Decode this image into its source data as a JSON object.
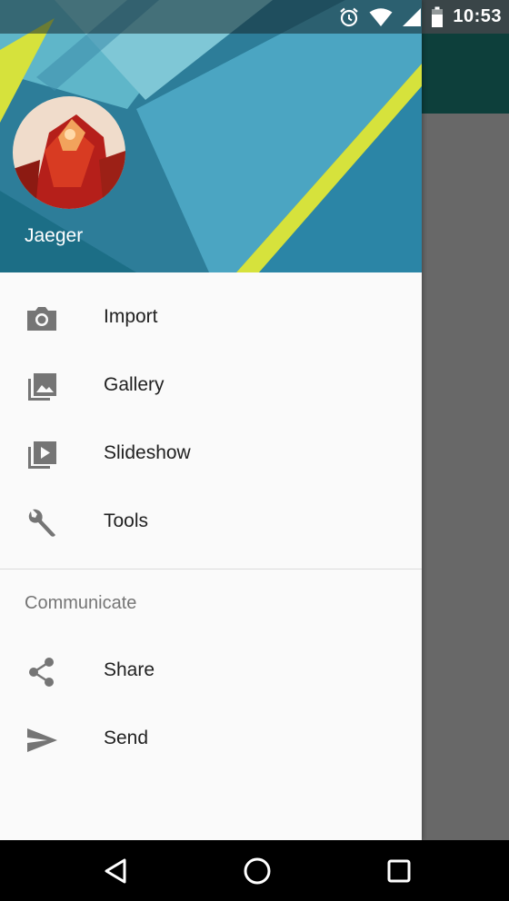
{
  "status_bar": {
    "time": "10:53",
    "icons": [
      "alarm-icon",
      "wifi-icon",
      "signal-icon",
      "battery-icon"
    ]
  },
  "drawer": {
    "header": {
      "user_name": "Jaeger",
      "colors": {
        "primary": "#2a7f9e",
        "accent": "#d6e23c"
      }
    },
    "items": [
      {
        "label": "Import",
        "icon": "camera-icon"
      },
      {
        "label": "Gallery",
        "icon": "photo-library-icon"
      },
      {
        "label": "Slideshow",
        "icon": "slideshow-icon"
      },
      {
        "label": "Tools",
        "icon": "wrench-icon"
      }
    ],
    "section": {
      "title": "Communicate",
      "items": [
        {
          "label": "Share",
          "icon": "share-icon"
        },
        {
          "label": "Send",
          "icon": "send-icon"
        }
      ]
    }
  },
  "nav_bar": {
    "buttons": [
      "back-icon",
      "home-icon",
      "recents-icon"
    ]
  }
}
